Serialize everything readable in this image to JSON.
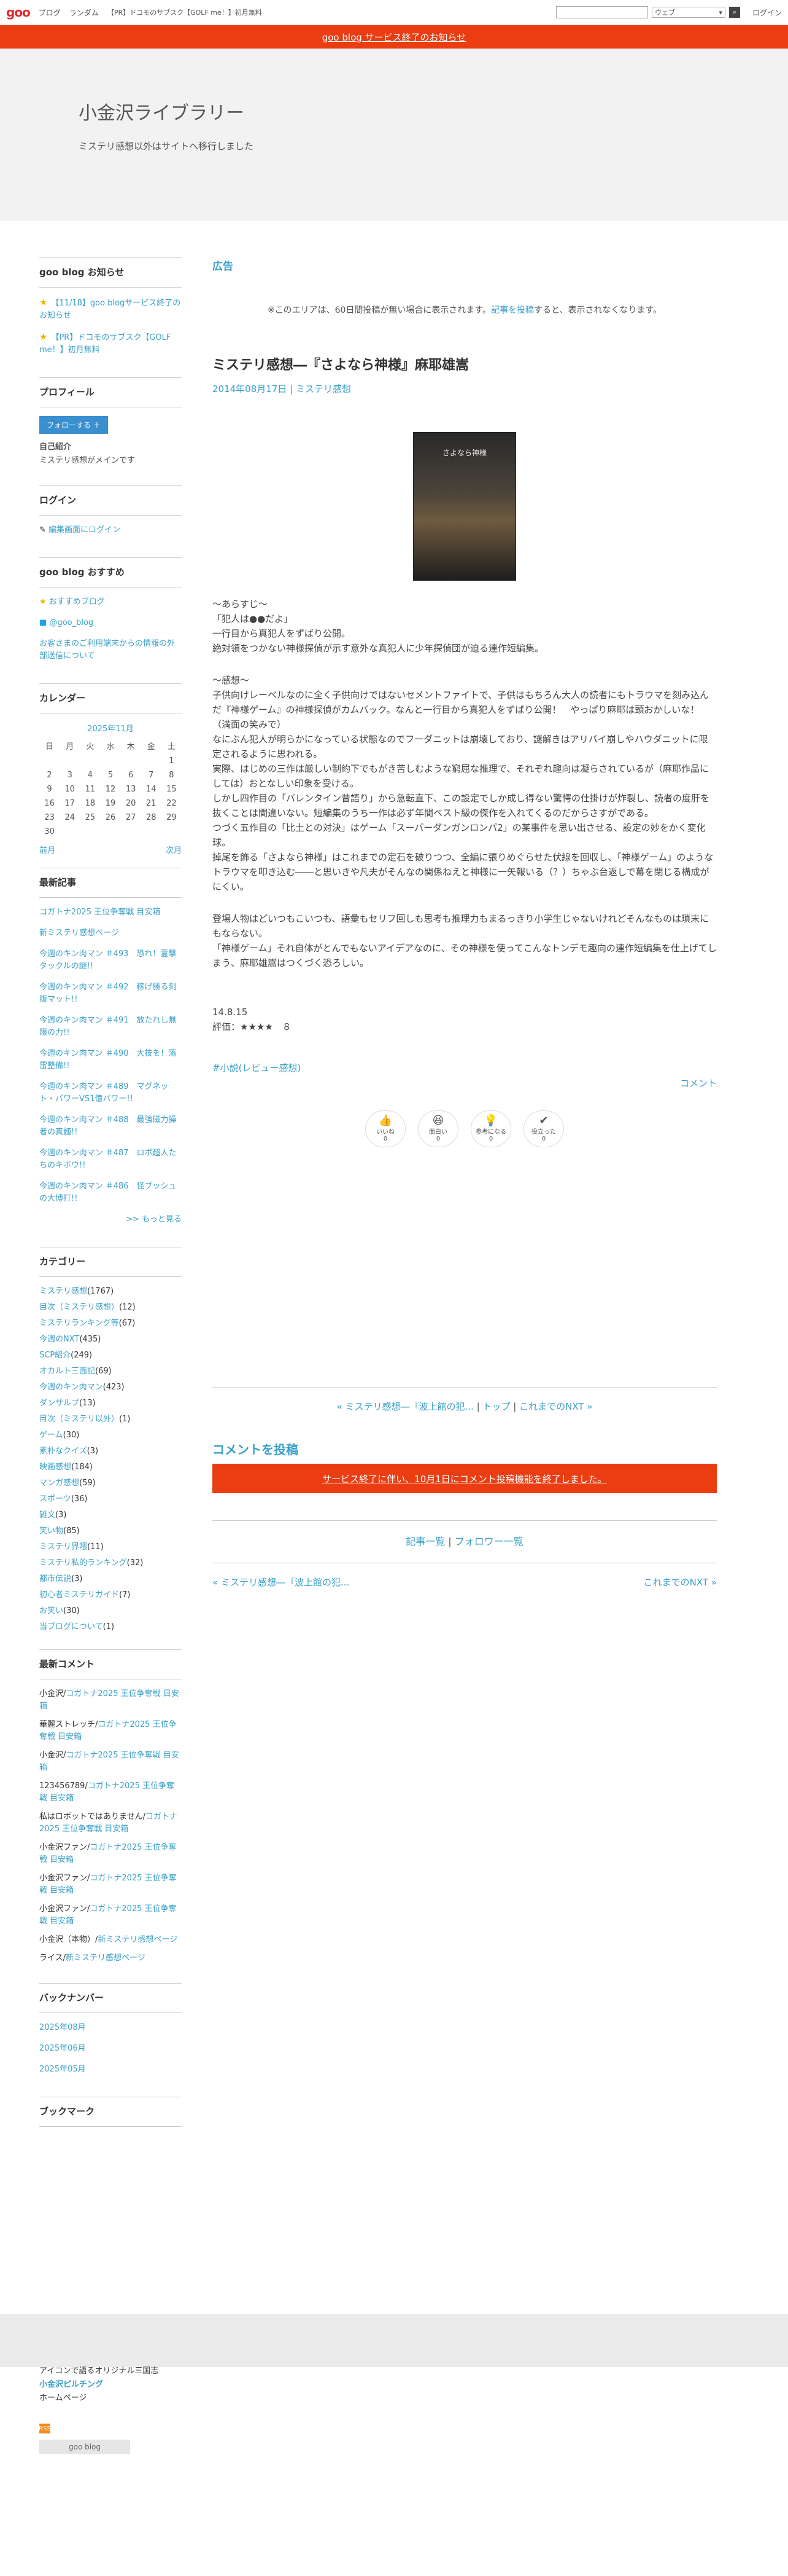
{
  "global_nav": {
    "logo": "goo",
    "items": [
      "ブログ",
      "ランダム"
    ],
    "promo": "【PR】ドコモのサブスク【GOLF me！】初月無料",
    "search_placeholder": "",
    "search_scope": "ウェブ",
    "search_icon": "search-icon",
    "login": "ログイン"
  },
  "notice": "goo blog サービス終了のお知らせ",
  "blog": {
    "title": "小金沢ライブラリー",
    "description": "ミステリ感想以外はサイトへ移行しました"
  },
  "sidebar": {
    "notices": {
      "title": "goo blog お知らせ",
      "items": [
        "【11/18】goo blogサービス終了のお知らせ",
        "【PR】ドコモのサブスク【GOLF me！】初月無料"
      ]
    },
    "profile": {
      "title": "プロフィール",
      "follow": "フォローする",
      "self_intro_label": "自己紹介",
      "self_intro": "ミステリ感想がメインです"
    },
    "login": {
      "title": "ログイン",
      "link": "編集画面にログイン"
    },
    "recommend": {
      "title": "goo blog おすすめ",
      "items": [
        "おすすめブログ",
        "@goo_blog",
        "お客さまのご利用端末からの情報の外部送信について"
      ]
    },
    "calendar": {
      "title": "カレンダー",
      "month": "2025年11月",
      "weekdays": [
        "日",
        "月",
        "火",
        "水",
        "木",
        "金",
        "土"
      ],
      "weeks": [
        [
          "",
          "",
          "",
          "",
          "",
          "",
          "1"
        ],
        [
          "2",
          "3",
          "4",
          "5",
          "6",
          "7",
          "8"
        ],
        [
          "9",
          "10",
          "11",
          "12",
          "13",
          "14",
          "15"
        ],
        [
          "16",
          "17",
          "18",
          "19",
          "20",
          "21",
          "22"
        ],
        [
          "23",
          "24",
          "25",
          "26",
          "27",
          "28",
          "29"
        ],
        [
          "30",
          "",
          "",
          "",
          "",
          "",
          ""
        ]
      ],
      "prev": "前月",
      "next": "次月"
    },
    "recent": {
      "title": "最新記事",
      "items": [
        "コガトナ2025 王位争奪戦 目安箱",
        "新ミステリ感想ページ",
        "今週のキン肉マン ＃493　恐れ！霊撃タックルの謎!!",
        "今週のキン肉マン ＃492　稼げ勝る刻腹マット!!",
        "今週のキン肉マン ＃491　放たれし無限の力!!",
        "今週のキン肉マン ＃490　大技を！落雷整備!!",
        "今週のキン肉マン ＃489　マグネット・パワーVS1億パワー!!",
        "今週のキン肉マン ＃488　最強磁力操者の真髄!!",
        "今週のキン肉マン ＃487　ロボ超人たちのキボウ!!",
        "今週のキン肉マン ＃486　怪ブッシュの大博打!!"
      ],
      "more": ">> もっと見る"
    },
    "categories": {
      "title": "カテゴリー",
      "items": [
        {
          "name": "ミステリ感想",
          "count": "(1767)"
        },
        {
          "name": "目次（ミステリ感想）",
          "count": "(12)"
        },
        {
          "name": "ミステリランキング等",
          "count": "(67)"
        },
        {
          "name": "今週のNXT",
          "count": "(435)"
        },
        {
          "name": "SCP紹介",
          "count": "(249)"
        },
        {
          "name": "オカルト三面記",
          "count": "(69)"
        },
        {
          "name": "今週のキン肉マン",
          "count": "(423)"
        },
        {
          "name": "ダンサルプ",
          "count": "(13)"
        },
        {
          "name": "目次（ミステリ以外）",
          "count": "(1)"
        },
        {
          "name": "ゲーム",
          "count": "(30)"
        },
        {
          "name": "素朴なクイズ",
          "count": "(3)"
        },
        {
          "name": "映画感想",
          "count": "(184)"
        },
        {
          "name": "マンガ感想",
          "count": "(59)"
        },
        {
          "name": "スポーツ",
          "count": "(36)"
        },
        {
          "name": "雑文",
          "count": "(3)"
        },
        {
          "name": "笑い物",
          "count": "(85)"
        },
        {
          "name": "ミステリ界隈",
          "count": "(11)"
        },
        {
          "name": "ミステリ私的ランキング",
          "count": "(32)"
        },
        {
          "name": "都市伝説",
          "count": "(3)"
        },
        {
          "name": "初心者ミステリガイド",
          "count": "(7)"
        },
        {
          "name": "お笑い",
          "count": "(30)"
        },
        {
          "name": "当ブログについて",
          "count": "(1)"
        }
      ]
    },
    "comments": {
      "title": "最新コメント",
      "items": [
        {
          "who": "小金沢",
          "on": "コガトナ2025 王位争奪戦 目安箱"
        },
        {
          "who": "華麗ストレッチ",
          "on": "コガトナ2025 王位争奪戦 目安箱"
        },
        {
          "who": "小金沢",
          "on": "コガトナ2025 王位争奪戦 目安箱"
        },
        {
          "who": "123456789",
          "on": "コガトナ2025 王位争奪戦 目安箱"
        },
        {
          "who": "私はロボットではありません",
          "on": "コガトナ2025 王位争奪戦 目安箱"
        },
        {
          "who": "小金沢ファン",
          "on": "コガトナ2025 王位争奪戦 目安箱"
        },
        {
          "who": "小金沢ファン",
          "on": "コガトナ2025 王位争奪戦 目安箱"
        },
        {
          "who": "小金沢ファン",
          "on": "コガトナ2025 王位争奪戦 目安箱"
        },
        {
          "who": "小金沢（本物）",
          "on": "新ミステリ感想ページ"
        },
        {
          "who": "ライス",
          "on": "新ミステリ感想ページ"
        }
      ]
    },
    "backnumber": {
      "title": "バックナンバー",
      "items": [
        "2025年08月",
        "2025年06月",
        "2025年05月"
      ]
    },
    "bookmark": {
      "title": "ブックマーク"
    }
  },
  "ad": {
    "title": "広告",
    "note_before": "※このエリアは、60日間投稿が無い場合に表示されます。",
    "note_link": "記事を投稿",
    "note_after": "すると、表示されなくなります。"
  },
  "entry": {
    "title": "ミステリ感想―『さよなら神様』麻耶雄嵩",
    "date": "2014年08月17日",
    "category": "ミステリ感想",
    "cover_title": "さよなら神様",
    "paragraphs": [
      "～あらすじ～",
      "「犯人は●●だよ」",
      "一行目から真犯人をずばり公開。",
      "絶対領をつかない神様探偵が示す意外な真犯人に少年探偵団が迫る連作短編集。",
      "",
      "～感想～",
      "子供向けレーベルなのに全く子供向けではないセメントファイトで、子供はもちろん大人の読者にもトラウマを刻み込んだ『神様ゲーム』の神様探偵がカムバック。なんと一行目から真犯人をずばり公開！　やっぱり麻耶は頭おかしいな！（満面の笑みで）",
      "なにぶん犯人が明らかになっている状態なのでフーダニットは崩壊しており、謎解きはアリバイ崩しやハウダニットに限定されるように思われる。",
      "実際、はじめの三作は厳しい制約下でもがき苦しむような窮屈な推理で、それぞれ趣向は凝らされているが（麻耶作品にしては）おとなしい印象を受ける。",
      "しかし四作目の「バレンタイン昔語り」から急転直下、この設定でしか成し得ない驚愕の仕掛けが炸裂し、読者の度肝を抜くことは間違いない。短編集のうち一作は必ず年間ベスト級の傑作を入れてくるのだからさすがである。",
      "つづく五作目の「比土との対決」はゲーム「スーパーダンガンロンパ2」の某事件を思い出させる、設定の妙をかく変化球。",
      "掉尾を飾る「さよなら神様」はこれまでの定石を破りつつ、全編に張りめぐらせた伏線を回収し、「神様ゲーム」のようなトラウマを叩き込む――と思いきや凡夫がそんなの関係ねえと神様に一矢報いる（？）ちゃぶ台返しで幕を閉じる構成がにくい。",
      "",
      "登場人物はどいつもこいつも、語彙もセリフ回しも思考も推理力もまるっきり小学生じゃないけれどそんなものは瑣末にもならない。",
      "「神様ゲーム」それ自体がとんでもないアイデアなのに、その神様を使ってこんなトンデモ趣向の連作短編集を仕上げてしまう、麻耶雄嵩はつくづく恐ろしい。",
      "",
      "",
      "14.8.15",
      "評価：★★★★　８"
    ],
    "tag": "#小説(レビュー感想)",
    "comment_link": "コメント",
    "reactions": [
      {
        "label": "いいね",
        "count": "0",
        "icon": "thumbs-up-icon"
      },
      {
        "label": "面白い",
        "count": "0",
        "icon": "laugh-icon"
      },
      {
        "label": "参考になる",
        "count": "0",
        "icon": "bulb-icon"
      },
      {
        "label": "役立った",
        "count": "0",
        "icon": "check-icon"
      }
    ]
  },
  "pagenav": {
    "prev": "« ミステリ感想―『波上館の犯...",
    "top": "トップ",
    "next": "これまでのNXT »"
  },
  "comment_post": {
    "title": "コメントを投稿",
    "message": "サービス終了に伴い、10月1日にコメント投稿機能を終了しました。"
  },
  "listlinks": {
    "articles": "記事一覧",
    "followers": "フォロワー一覧"
  },
  "bottom_nav": {
    "prev": "« ミステリ感想―『波上館の犯...",
    "next": "これまでのNXT »"
  },
  "footer": {
    "lines": [
      "アイコンで語るオリジナル三国志",
      "小金沢ピルチング",
      "ホームページ"
    ],
    "rss": "RSS",
    "goo_blog": "goo blog"
  }
}
